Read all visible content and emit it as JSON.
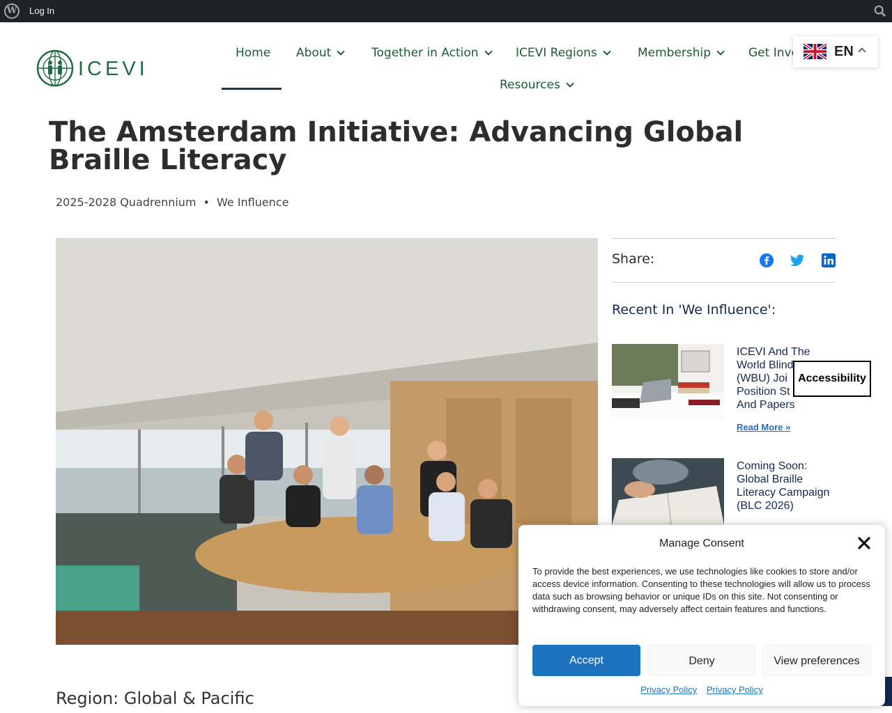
{
  "admin_bar": {
    "login_label": "Log In"
  },
  "nav": {
    "items": [
      {
        "label": "Home",
        "has_dropdown": false,
        "active": true
      },
      {
        "label": "About",
        "has_dropdown": true
      },
      {
        "label": "Together in Action",
        "has_dropdown": true
      },
      {
        "label": "ICEVI Regions",
        "has_dropdown": true
      },
      {
        "label": "Membership",
        "has_dropdown": true
      },
      {
        "label": "Get Involved",
        "has_dropdown": true
      },
      {
        "label": "Resources",
        "has_dropdown": true
      }
    ]
  },
  "logo": {
    "text": "ICEVI",
    "color": "#1e6b45"
  },
  "language": {
    "code": "EN",
    "flag_icon": "uk-flag-icon"
  },
  "article": {
    "title": "The Amsterdam Initiative: Advancing Global Braille Literacy",
    "categories": [
      "2025-2028 Quadrennium",
      "We Influence"
    ],
    "separator": "•",
    "region_label": "Region: Global & Pacific"
  },
  "sidebar": {
    "share_label": "Share:",
    "share_icons": [
      "facebook-icon",
      "twitter-icon",
      "linkedin-icon"
    ],
    "recent_title": "Recent In 'We Influence':",
    "posts": [
      {
        "title": "ICEVI And The World Blind Union (WBU) Joint Position Statements And Papers",
        "visible_title_lines": [
          "ICEVI And The",
          "World Blind",
          "(WBU) Joi",
          "Position St",
          "And Papers"
        ],
        "read_more": "Read More »"
      },
      {
        "title": "Coming Soon: Global Braille Literacy Campaign (BLC 2026)",
        "visible_title_lines": [
          "Coming Soon:",
          "Global Braille",
          "Literacy Campaign",
          "(BLC 2026)"
        ]
      }
    ]
  },
  "accessibility_button": {
    "label": "Accessibility"
  },
  "consent": {
    "title": "Manage Consent",
    "body": "To provide the best experiences, we use technologies like cookies to store and/or access device information. Consenting to these technologies will allow us to process data such as browsing behavior or unique IDs on this site. Not consenting or withdrawing consent, may adversely affect certain features and functions.",
    "accept_label": "Accept",
    "deny_label": "Deny",
    "preferences_label": "View preferences",
    "links": [
      "Privacy Policy",
      "Privacy Policy"
    ]
  },
  "colors": {
    "admin_bar": "#1d2327",
    "nav_text": "#1e5a3a",
    "accept_button": "#1e73be",
    "heading_navy": "#142850",
    "link_blue": "#2969c7"
  }
}
